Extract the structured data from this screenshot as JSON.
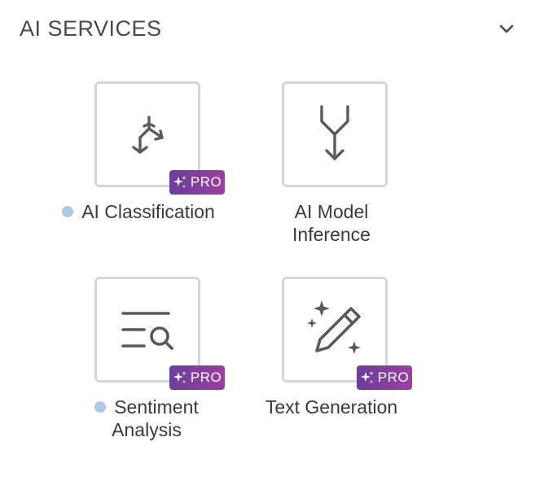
{
  "section": {
    "title": "AI SERVICES",
    "collapse_icon": "chevron-down-icon"
  },
  "badge": {
    "label": "PRO",
    "gradient_start": "#6a3f9c",
    "gradient_end": "#9b3f9e"
  },
  "colors": {
    "status_dot": "#a9c8e8",
    "tile_border": "#d6d6d6",
    "icon_stroke": "#5a5a5a"
  },
  "tiles": [
    {
      "label": "AI Classification",
      "icon": "branch-split-icon",
      "pro": true,
      "status_dot": true
    },
    {
      "label_line1": "AI Model",
      "label_line2": "Inference",
      "icon": "merge-arrow-down-icon",
      "pro": false,
      "status_dot": false
    },
    {
      "label_line1": "Sentiment",
      "label_line2": "Analysis",
      "icon": "text-search-icon",
      "pro": true,
      "status_dot": true
    },
    {
      "label": "Text Generation",
      "icon": "magic-pencil-icon",
      "pro": true,
      "status_dot": false
    }
  ]
}
